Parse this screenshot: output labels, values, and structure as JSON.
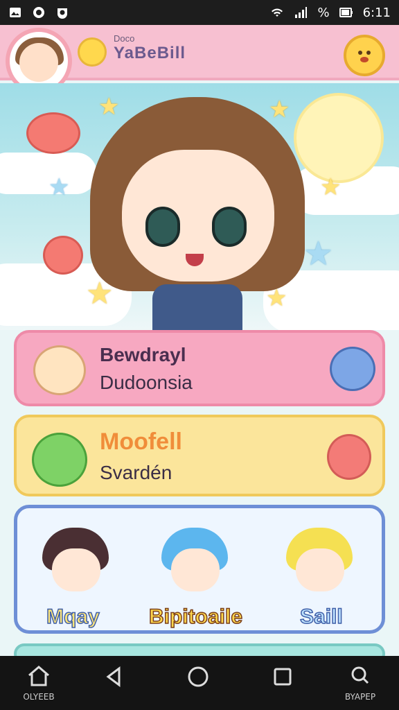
{
  "status_bar": {
    "right_text": "%",
    "time": "6:11"
  },
  "header": {
    "subtitle": "Doco",
    "title": "YaBeBill"
  },
  "cards": [
    {
      "line1": "Bewdrayl",
      "line2": "Dudoonsia"
    },
    {
      "line1": "Moofell",
      "line2": "Svardén"
    }
  ],
  "characters": [
    {
      "name": "Mqay",
      "name_color": "#ffe67a"
    },
    {
      "name": "Bipitoaile",
      "name_color": "#ffd84d"
    },
    {
      "name": "Saill",
      "name_color": "#bfe3ff"
    }
  ],
  "nav": {
    "home_label": "OLYEEB",
    "search_label": "BYAPEP"
  }
}
